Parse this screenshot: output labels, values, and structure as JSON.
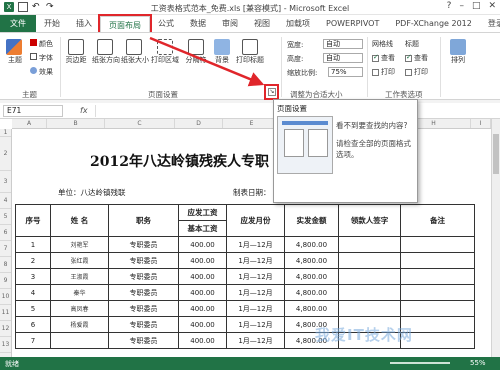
{
  "window": {
    "title": "工资表格式范本_免费.xls [兼容模式] - Microsoft Excel",
    "controls": [
      "?",
      "–",
      "□",
      "✕"
    ]
  },
  "tabs": [
    "文件",
    "开始",
    "插入",
    "页面布局",
    "公式",
    "数据",
    "审阅",
    "视图",
    "加载项",
    "POWERPIVOT",
    "PDF-XChange 2012",
    "登录"
  ],
  "ribbon": {
    "theme_group": {
      "label": "主题",
      "items": [
        "颜色",
        "字体",
        "效果"
      ],
      "big": "主题"
    },
    "page_setup_group": {
      "label": "页面设置",
      "buttons": [
        "页边距",
        "纸张方向",
        "纸张大小",
        "打印区域",
        "分隔符",
        "背景",
        "打印标题"
      ]
    },
    "scale_group": {
      "label": "调整为合适大小",
      "width_label": "宽度:",
      "width_value": "自动",
      "height_label": "高度:",
      "height_value": "自动",
      "scale_label": "缩放比例:",
      "scale_value": "75%"
    },
    "sheet_options_group": {
      "label": "工作表选项",
      "gridlines": "网格线",
      "headings": "标题",
      "view": "查看",
      "print": "打印",
      "gridlines_view": true,
      "gridlines_print": false,
      "headings_view": true,
      "headings_print": false
    },
    "arrange_group": {
      "label": "排列"
    }
  },
  "formula_bar": {
    "name_box": "E71",
    "fx": "fx"
  },
  "columns": [
    "A",
    "B",
    "C",
    "D",
    "E",
    "F",
    "G",
    "H",
    "I"
  ],
  "rows": [
    "1",
    "2",
    "3",
    "4",
    "5",
    "6",
    "7",
    "8",
    "9",
    "10",
    "11",
    "12",
    "13",
    "14"
  ],
  "sheet": {
    "title": "2012年八达岭镇残疾人专职",
    "unit": "单位：八达岭镇残联",
    "date_label": "制表日期：",
    "headers": {
      "seq": "序号",
      "name": "姓  名",
      "position": "职务",
      "salary_group": "应发工资",
      "base": "基本工资",
      "month": "应发月份",
      "actual": "实发金额",
      "sign": "领款人签字",
      "note": "备注"
    },
    "rows": [
      {
        "seq": "1",
        "name": "刘艳军",
        "position": "专职委员",
        "base": "400.00",
        "month": "1月—12月",
        "actual": "4,800.00"
      },
      {
        "seq": "2",
        "name": "张红霞",
        "position": "专职委员",
        "base": "400.00",
        "month": "1月—12月",
        "actual": "4,800.00"
      },
      {
        "seq": "3",
        "name": "王淑霞",
        "position": "专职委员",
        "base": "400.00",
        "month": "1月—12月",
        "actual": "4,800.00"
      },
      {
        "seq": "4",
        "name": "秦华",
        "position": "专职委员",
        "base": "400.00",
        "month": "1月—12月",
        "actual": "4,800.00"
      },
      {
        "seq": "5",
        "name": "高凤春",
        "position": "专职委员",
        "base": "400.00",
        "month": "1月—12月",
        "actual": "4,800.00"
      },
      {
        "seq": "6",
        "name": "杨爱霞",
        "position": "专职委员",
        "base": "400.00",
        "month": "1月—12月",
        "actual": "4,800.00"
      },
      {
        "seq": "7",
        "name": "",
        "position": "专职委员",
        "base": "400.00",
        "month": "1月—12月",
        "actual": "4,800.00"
      }
    ]
  },
  "popup": {
    "title": "页面设置",
    "line1": "看不到要查找的内容?",
    "line2": "请检查全部的页面格式",
    "line3": "选项。"
  },
  "status": {
    "ready": "就绪",
    "zoom": "55%"
  },
  "watermark": "我爱IT技术网",
  "colors": {
    "excel_green": "#217346",
    "highlight": "#e0262b"
  }
}
